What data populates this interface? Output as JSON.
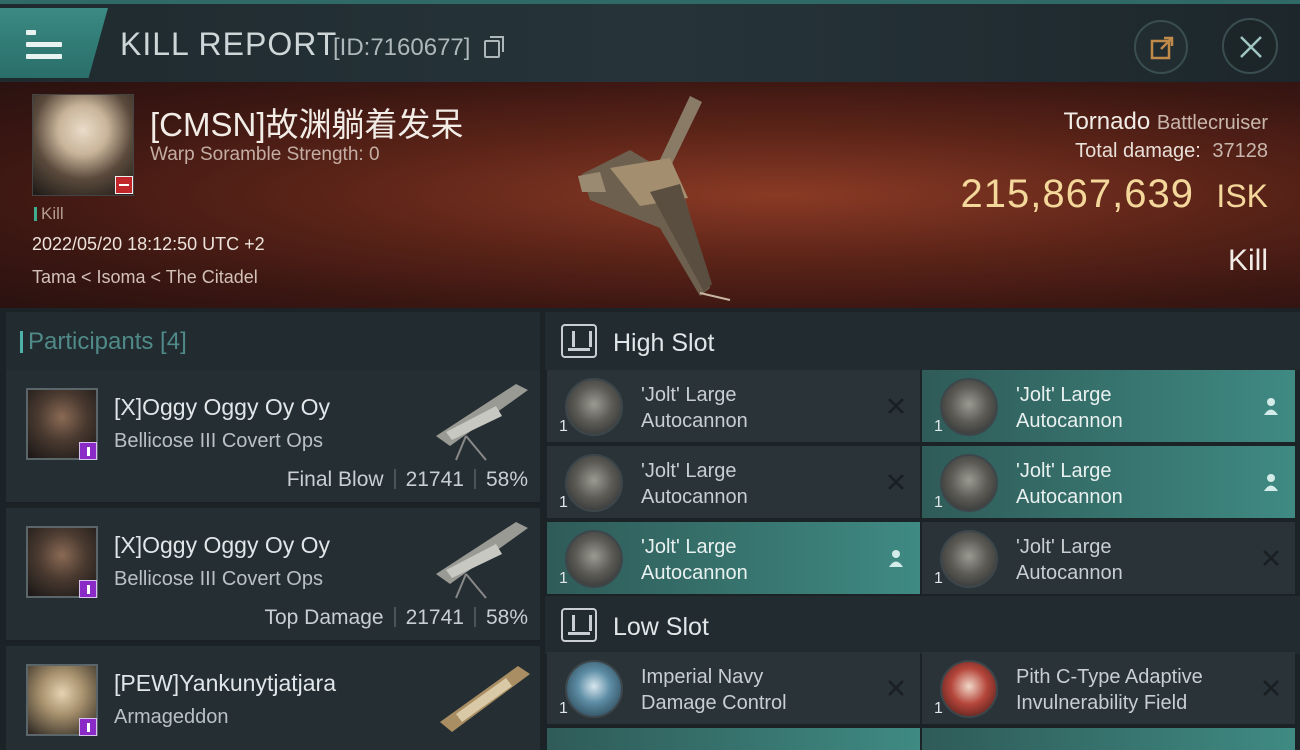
{
  "header": {
    "title": "KILL REPORT",
    "report_id": "[ID:7160677]"
  },
  "victim": {
    "name": "[CMSN]故渊躺着发呆",
    "scramble": "Warp Soramble Strength: 0",
    "tag": "Kill",
    "datetime": "2022/05/20 18:12:50 UTC +2",
    "location": "Tama < Isoma < The Citadel",
    "ship": "Tornado",
    "ship_class": "Battlecruiser",
    "total_damage_label": "Total damage:",
    "total_damage": "37128",
    "isk_value": "215,867,639",
    "isk_unit": "ISK",
    "result": "Kill"
  },
  "participants": {
    "label": "Participants [4]",
    "items": [
      {
        "name": "[X]Oggy Oggy Oy Oy",
        "ship": "Bellicose III Covert Ops",
        "role": "Final Blow",
        "damage": "21741",
        "percent": "58%"
      },
      {
        "name": "[X]Oggy Oggy Oy Oy",
        "ship": "Bellicose III Covert Ops",
        "role": "Top Damage",
        "damage": "21741",
        "percent": "58%"
      },
      {
        "name": "[PEW]Yankunytjatjara",
        "ship": "Armageddon",
        "role": "",
        "damage": "",
        "percent": ""
      }
    ]
  },
  "slots": {
    "high": {
      "label": "High Slot",
      "modules": [
        {
          "qty": "1",
          "line1": "'Jolt' Large",
          "line2": "Autocannon",
          "mark": "x"
        },
        {
          "qty": "1",
          "line1": "'Jolt' Large",
          "line2": "Autocannon",
          "mark": "person"
        },
        {
          "qty": "1",
          "line1": "'Jolt' Large",
          "line2": "Autocannon",
          "mark": "x"
        },
        {
          "qty": "1",
          "line1": "'Jolt' Large",
          "line2": "Autocannon",
          "mark": "person"
        },
        {
          "qty": "1",
          "line1": "'Jolt' Large",
          "line2": "Autocannon",
          "mark": "person"
        },
        {
          "qty": "1",
          "line1": "'Jolt' Large",
          "line2": "Autocannon",
          "mark": "x"
        }
      ]
    },
    "low": {
      "label": "Low Slot",
      "modules": [
        {
          "qty": "1",
          "line1": "Imperial Navy",
          "line2": "Damage Control",
          "mark": "x"
        },
        {
          "qty": "1",
          "line1": "Pith C-Type Adaptive",
          "line2": "Invulnerability Field",
          "mark": "x"
        }
      ]
    }
  },
  "colors": {
    "accent": "#3f8a83",
    "isk": "#f4d89b",
    "kill_tag": "#3fae8f"
  }
}
